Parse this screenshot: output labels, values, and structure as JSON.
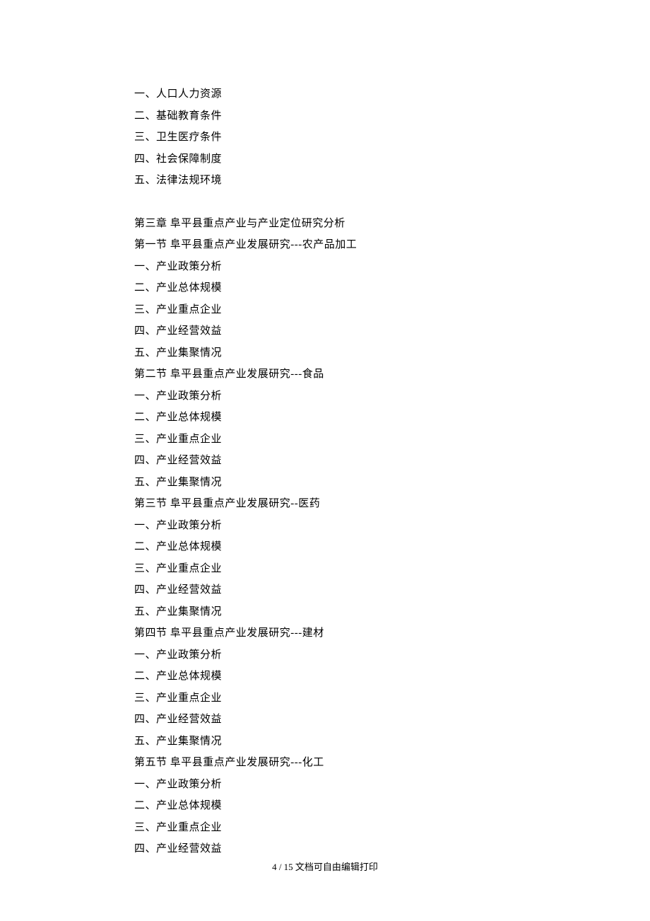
{
  "lines": [
    "一、人口人力资源",
    "二、基础教育条件",
    "三、卫生医疗条件",
    "四、社会保障制度",
    "五、法律法规环境",
    "",
    "第三章 阜平县重点产业与产业定位研究分析",
    "第一节 阜平县重点产业发展研究---农产品加工",
    "一、产业政策分析",
    "二、产业总体规模",
    "三、产业重点企业",
    "四、产业经营效益",
    "五、产业集聚情况",
    "第二节 阜平县重点产业发展研究---食品",
    "一、产业政策分析",
    "二、产业总体规模",
    "三、产业重点企业",
    "四、产业经营效益",
    "五、产业集聚情况",
    "第三节 阜平县重点产业发展研究--医药",
    "一、产业政策分析",
    "二、产业总体规模",
    "三、产业重点企业",
    "四、产业经营效益",
    "五、产业集聚情况",
    "第四节 阜平县重点产业发展研究---建材",
    "一、产业政策分析",
    "二、产业总体规模",
    "三、产业重点企业",
    "四、产业经营效益",
    "五、产业集聚情况",
    "第五节 阜平县重点产业发展研究---化工",
    "一、产业政策分析",
    "二、产业总体规模",
    "三、产业重点企业",
    "四、产业经营效益"
  ],
  "footer": "4 / 15 文档可自由编辑打印"
}
